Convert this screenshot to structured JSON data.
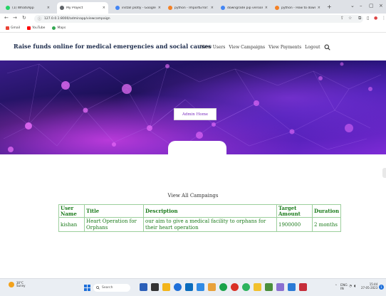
{
  "browser": {
    "tabs": [
      {
        "label": "(1) WhatsApp",
        "active": false,
        "color": "#25d366"
      },
      {
        "label": "My Project",
        "active": true,
        "color": "#5f6368"
      },
      {
        "label": "install plotly - Google Sear",
        "active": false,
        "color": "#4285f4"
      },
      {
        "label": "python - ImportError: can",
        "active": false,
        "color": "#f48024"
      },
      {
        "label": "downgrade pip version - S",
        "active": false,
        "color": "#4285f4"
      },
      {
        "label": "python - How to downgra",
        "active": false,
        "color": "#f48024"
      }
    ],
    "new_tab": "+",
    "url": "127.0.0.1:8000/adminapp/viewcampaign",
    "bookmarks": [
      {
        "label": "Gmail",
        "color": "#ea4335"
      },
      {
        "label": "YouTube",
        "color": "#ff0000"
      },
      {
        "label": "Maps",
        "color": "#34a853"
      }
    ]
  },
  "site": {
    "brand": "Raise funds online for medical emergencies and social causes",
    "nav": [
      "View Users",
      "View Campaigns",
      "View Payments",
      "Logout"
    ]
  },
  "hero": {
    "button_label": "Admin Home"
  },
  "campaigns": {
    "title": "View All Campaings",
    "columns": [
      "User Name",
      "Title",
      "Description",
      "Target Amount",
      "Duration"
    ],
    "rows": [
      [
        "kishan",
        "Heart Operation for Orphans",
        "our aim to give a medical facility to orphans for their heart operation",
        "1900000",
        "2 months"
      ]
    ]
  },
  "taskbar": {
    "weather_temp": "30°C",
    "weather_text": "Sunny",
    "search_label": "Search",
    "lang": "ENG",
    "region": "IN",
    "time": "15:44",
    "date": "27-05-2023",
    "notifications": "1"
  },
  "colors": {
    "hero_dark": "#1a0f55",
    "hero_mid": "#5b1fc9",
    "hero_pink": "#e23ce8",
    "table_text": "#1a7a1a",
    "table_border": "#9ccf9c"
  }
}
